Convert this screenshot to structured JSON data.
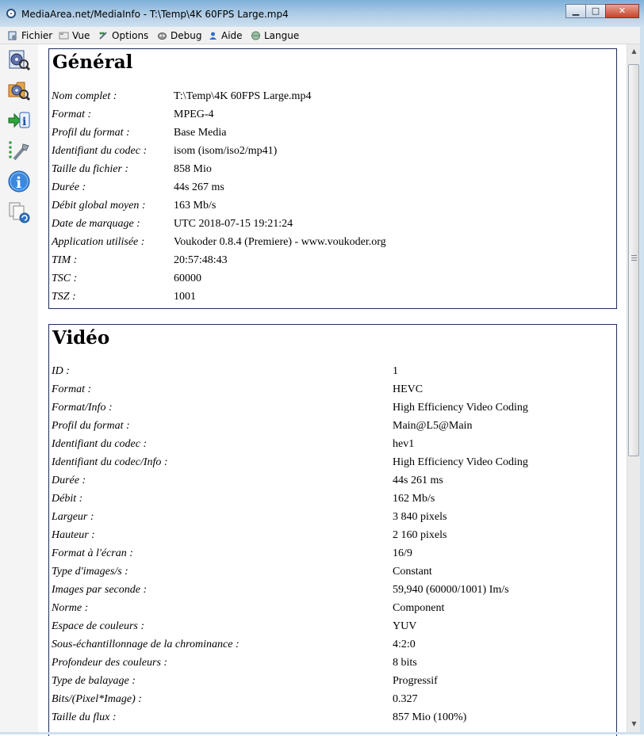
{
  "window": {
    "title": "MediaArea.net/MediaInfo - T:\\Temp\\4K 60FPS Large.mp4"
  },
  "menu": [
    {
      "label": "Fichier",
      "icon": "file-icon"
    },
    {
      "label": "Vue",
      "icon": "view-icon"
    },
    {
      "label": "Options",
      "icon": "options-icon"
    },
    {
      "label": "Debug",
      "icon": "debug-icon"
    },
    {
      "label": "Aide",
      "icon": "help-icon"
    },
    {
      "label": "Langue",
      "icon": "language-icon"
    }
  ],
  "toolbar": [
    {
      "name": "open-file-icon"
    },
    {
      "name": "open-folder-icon"
    },
    {
      "name": "export-icon"
    },
    {
      "name": "preferences-icon"
    },
    {
      "name": "about-icon"
    },
    {
      "name": "update-icon"
    }
  ],
  "sections": {
    "general": {
      "title": "Général",
      "rows": [
        {
          "key": "Nom complet :",
          "value": "T:\\Temp\\4K 60FPS Large.mp4"
        },
        {
          "key": "Format :",
          "value": "MPEG-4"
        },
        {
          "key": "Profil du format :",
          "value": "Base Media"
        },
        {
          "key": "Identifiant du codec :",
          "value": "isom (isom/iso2/mp41)"
        },
        {
          "key": "Taille du fichier :",
          "value": "858 Mio"
        },
        {
          "key": "Durée :",
          "value": "44s 267 ms"
        },
        {
          "key": "Débit global moyen :",
          "value": "163 Mb/s"
        },
        {
          "key": "Date de marquage :",
          "value": "UTC 2018-07-15 19:21:24"
        },
        {
          "key": "Application utilisée :",
          "value": "Voukoder 0.8.4 (Premiere) - www.voukoder.org"
        },
        {
          "key": "TIM :",
          "value": "20:57:48:43"
        },
        {
          "key": "TSC :",
          "value": "60000"
        },
        {
          "key": "TSZ :",
          "value": "1001"
        }
      ]
    },
    "video": {
      "title": "Vidéo",
      "rows": [
        {
          "key": "ID :",
          "value": "1"
        },
        {
          "key": "Format :",
          "value": "HEVC"
        },
        {
          "key": "Format/Info :",
          "value": "High Efficiency Video Coding"
        },
        {
          "key": "Profil du format :",
          "value": "Main@L5@Main"
        },
        {
          "key": "Identifiant du codec :",
          "value": "hev1"
        },
        {
          "key": "Identifiant du codec/Info :",
          "value": "High Efficiency Video Coding"
        },
        {
          "key": "Durée :",
          "value": "44s 261 ms"
        },
        {
          "key": "Débit :",
          "value": "162 Mb/s"
        },
        {
          "key": "Largeur :",
          "value": "3 840 pixels"
        },
        {
          "key": "Hauteur :",
          "value": "2 160 pixels"
        },
        {
          "key": "Format à l'écran :",
          "value": "16/9"
        },
        {
          "key": "Type d'images/s :",
          "value": "Constant"
        },
        {
          "key": "Images par seconde :",
          "value": "59,940 (60000/1001) Im/s"
        },
        {
          "key": "Norme :",
          "value": "Component"
        },
        {
          "key": "Espace de couleurs :",
          "value": "YUV"
        },
        {
          "key": "Sous-échantillonnage de la chrominance :",
          "value": "4:2:0"
        },
        {
          "key": "Profondeur des couleurs :",
          "value": "8 bits"
        },
        {
          "key": "Type de balayage :",
          "value": "Progressif"
        },
        {
          "key": "Bits/(Pixel*Image) :",
          "value": "0.327"
        },
        {
          "key": "Taille du flux :",
          "value": "857 Mio (100%)"
        }
      ]
    }
  }
}
